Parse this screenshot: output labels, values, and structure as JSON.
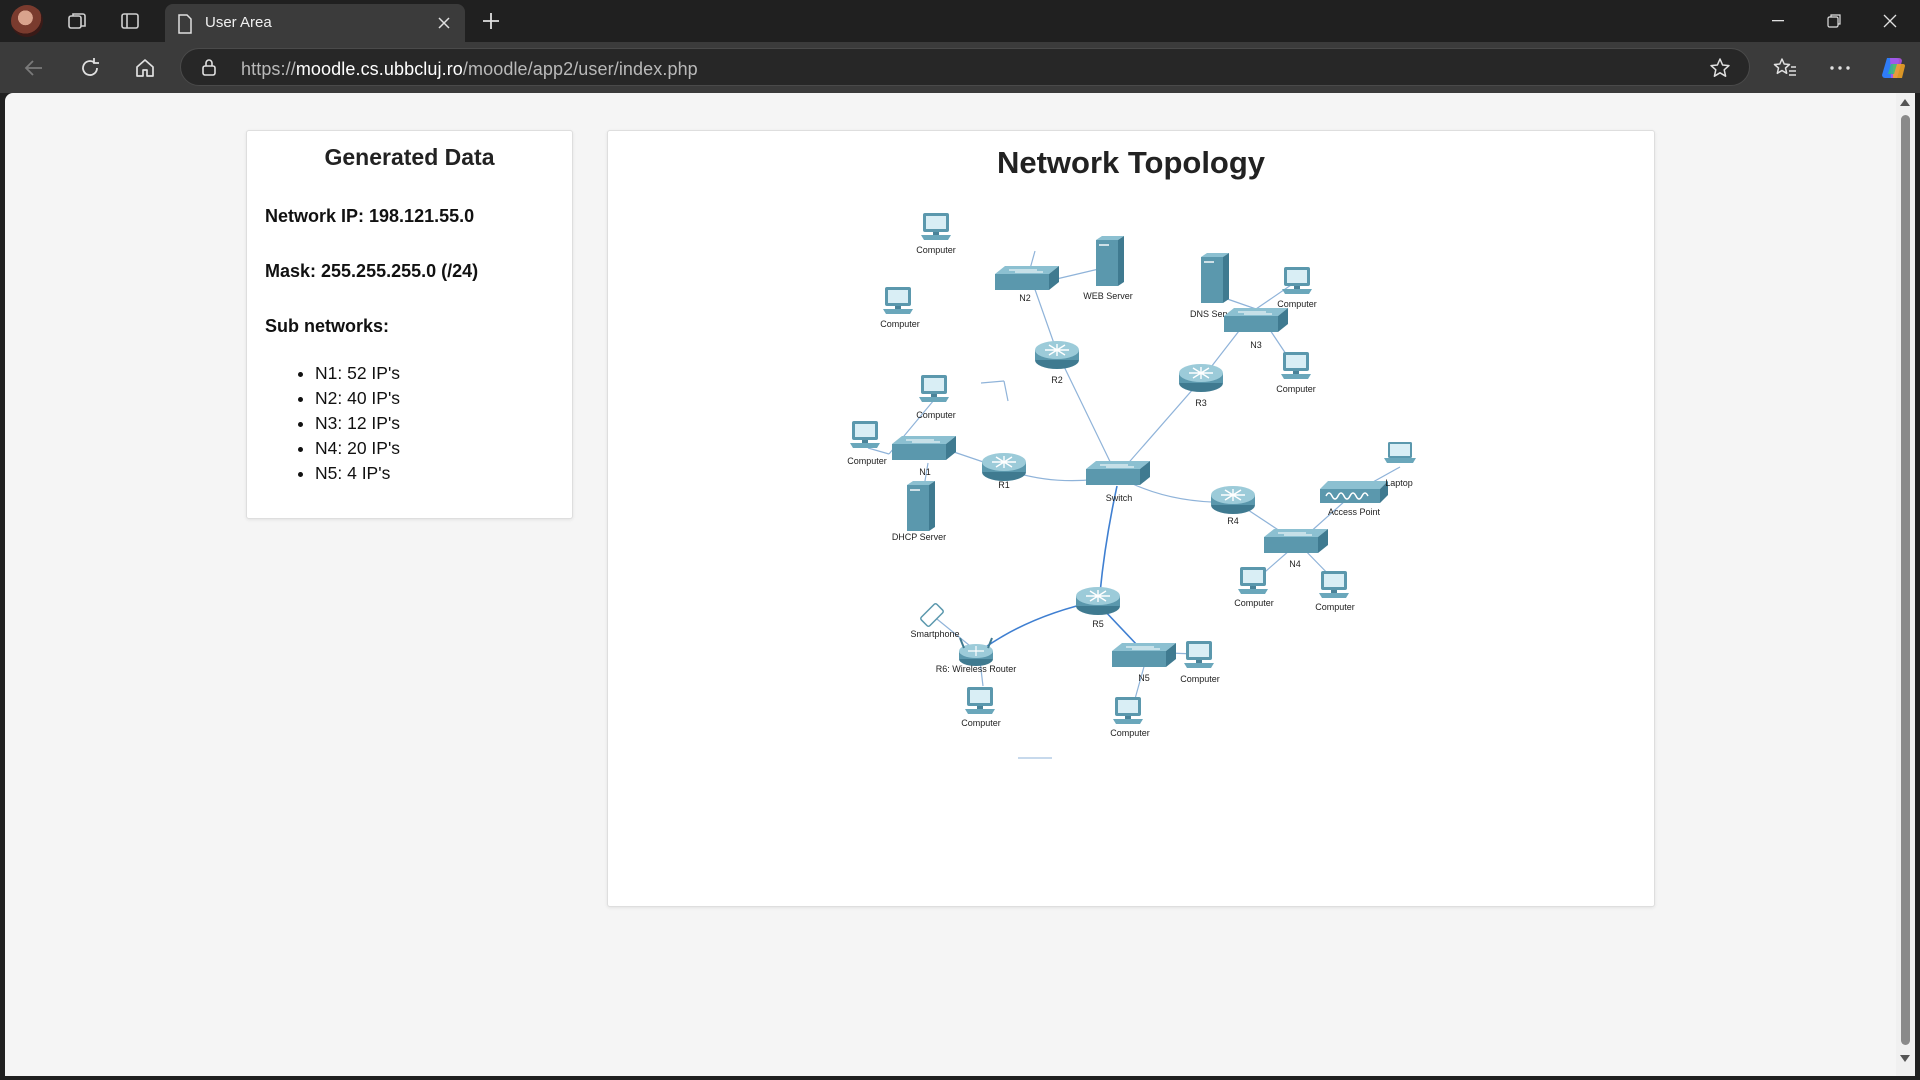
{
  "browser": {
    "tab_title": "User Area",
    "url_scheme": "https://",
    "url_host": "moodle.cs.ubbcluj.ro",
    "url_path": "/moodle/app2/user/index.php"
  },
  "generated_data": {
    "heading": "Generated Data",
    "network_ip": "Network IP: 198.121.55.0",
    "mask": "Mask: 255.255.255.0 (/24)",
    "subnets_heading": "Sub networks:",
    "subnets": [
      "N1: 52 IP's",
      "N2: 40 IP's",
      "N3: 12 IP's",
      "N4: 20 IP's",
      "N5: 4 IP's"
    ]
  },
  "topology": {
    "heading": "Network Topology",
    "labels": {
      "switch": "Switch",
      "r1": "R1",
      "r2": "R2",
      "r3": "R3",
      "r4": "R4",
      "r5": "R5",
      "r6": "R6: Wireless Router",
      "n1": "N1",
      "n2": "N2",
      "n3": "N3",
      "n4": "N4",
      "n5": "N5",
      "computer": "Computer",
      "dhcp": "DHCP Server",
      "web": "WEB Server",
      "dns": "DNS Server",
      "laptop": "Laptop",
      "ap": "Access Point",
      "smartphone": "Smartphone"
    }
  },
  "colors": {
    "device": "#5b98ad",
    "link": "#8fb3d9",
    "link_dark": "#3f7fd1"
  }
}
